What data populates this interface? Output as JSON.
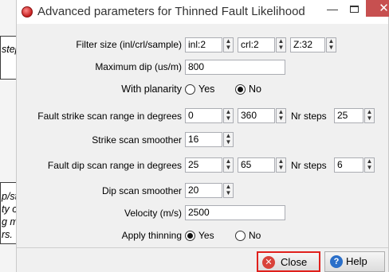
{
  "background_notes": {
    "top_fragment": "stepout",
    "bottom_lines": [
      "p/strike",
      "ty of a fault",
      "g may also",
      "rs."
    ]
  },
  "window": {
    "title": "Advanced parameters for Thinned Fault Likelihood",
    "minimize_glyph": "—",
    "close_glyph": "✕"
  },
  "form": {
    "filter_size": {
      "label": "Filter size (inl/crl/sample)",
      "inl": "inl:2",
      "crl": "crl:2",
      "z": "Z:32"
    },
    "max_dip": {
      "label": "Maximum dip (us/m)",
      "value": "800"
    },
    "with_planarity": {
      "label": "With planarity",
      "yes": "Yes",
      "no": "No",
      "selected": "No"
    },
    "strike_range": {
      "label": "Fault strike scan range in degrees",
      "min": "0",
      "max": "360",
      "steps_label": "Nr steps",
      "steps": "25"
    },
    "strike_smoother": {
      "label": "Strike scan smoother",
      "value": "16"
    },
    "dip_range": {
      "label": "Fault dip scan range in degrees",
      "min": "25",
      "max": "65",
      "steps_label": "Nr steps",
      "steps": "6"
    },
    "dip_smoother": {
      "label": "Dip scan smoother",
      "value": "20"
    },
    "velocity": {
      "label": "Velocity (m/s)",
      "value": "2500"
    },
    "apply_thinning": {
      "label": "Apply thinning",
      "yes": "Yes",
      "no": "No",
      "selected": "Yes"
    }
  },
  "buttons": {
    "close": "Close",
    "help": "Help"
  },
  "colors": {
    "close_highlight": "#e0201c",
    "titlebar_close": "#c75050",
    "help_icon": "#2a6fc9",
    "close_icon": "#d9423a"
  }
}
